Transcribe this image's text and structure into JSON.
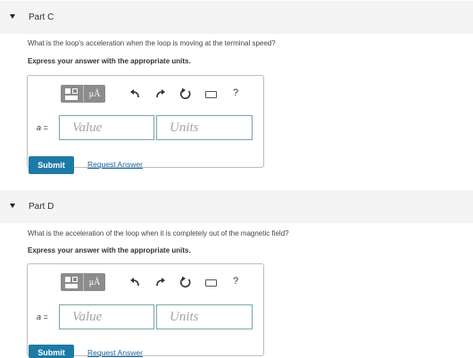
{
  "parts": [
    {
      "title": "Part C",
      "question": "What is the loop's acceleration when the loop is moving at the terminal speed?",
      "instruction": "Express your answer with the appropriate units.",
      "variable_label": "a =",
      "value_placeholder": "Value",
      "units_placeholder": "Units",
      "submit_label": "Submit",
      "request_label": "Request Answer",
      "units_button_label": "μÅ",
      "help_label": "?"
    },
    {
      "title": "Part D",
      "question": "What is the acceleration of the loop when it is completely out of the magnetic field?",
      "instruction": "Express your answer with the appropriate units.",
      "variable_label": "a =",
      "value_placeholder": "Value",
      "units_placeholder": "Units",
      "submit_label": "Submit",
      "request_label": "Request Answer",
      "units_button_label": "μÅ",
      "help_label": "?"
    }
  ],
  "icons": {
    "collapse": "caret-down-icon",
    "templates": "templates-icon",
    "undo": "undo-icon",
    "redo": "redo-icon",
    "reset": "reset-icon",
    "keyboard": "keyboard-icon",
    "help": "help-icon"
  },
  "colors": {
    "submit_bg": "#1d7aa6",
    "link": "#1a67a3",
    "field_border": "#7aa6a9",
    "toolbar_btn": "#8c8c8c",
    "header_bg": "#f4f4f4"
  }
}
